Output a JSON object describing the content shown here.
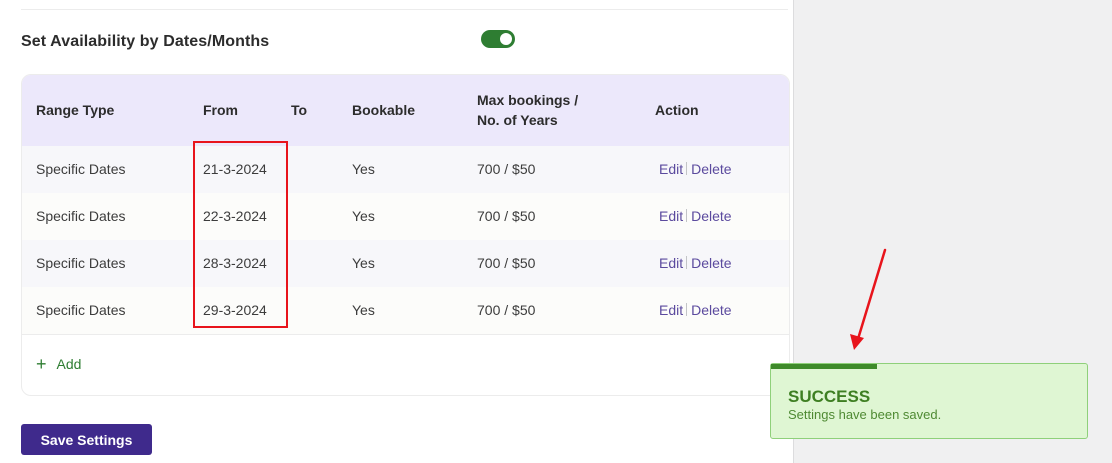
{
  "section": {
    "title": "Set Availability by Dates/Months",
    "toggle_on": true,
    "toggle_color": "#2e7d32"
  },
  "table": {
    "headers": {
      "range_type": "Range Type",
      "from": "From",
      "to": "To",
      "bookable": "Bookable",
      "max_line1": "Max bookings /",
      "max_line2": "No. of Years",
      "action": "Action"
    },
    "rows": [
      {
        "range_type": "Specific Dates",
        "from": "21-3-2024",
        "to": "",
        "bookable": "Yes",
        "max": "700 / $50",
        "edit": "Edit",
        "delete": "Delete"
      },
      {
        "range_type": "Specific Dates",
        "from": "22-3-2024",
        "to": "",
        "bookable": "Yes",
        "max": "700 / $50",
        "edit": "Edit",
        "delete": "Delete"
      },
      {
        "range_type": "Specific Dates",
        "from": "28-3-2024",
        "to": "",
        "bookable": "Yes",
        "max": "700 / $50",
        "edit": "Edit",
        "delete": "Delete"
      },
      {
        "range_type": "Specific Dates",
        "from": "29-3-2024",
        "to": "",
        "bookable": "Yes",
        "max": "700 / $50",
        "edit": "Edit",
        "delete": "Delete"
      }
    ],
    "add_label": "Add",
    "header_bg": "#ece8fb"
  },
  "save_button": {
    "label": "Save Settings",
    "color": "#3f2a8c"
  },
  "toast": {
    "title": "SUCCESS",
    "message": "Settings have been saved.",
    "bg": "#dff6d3",
    "accent": "#3e8a2a"
  },
  "annotations": {
    "highlight_color": "#e8141c",
    "arrow_color": "#e8141c"
  }
}
